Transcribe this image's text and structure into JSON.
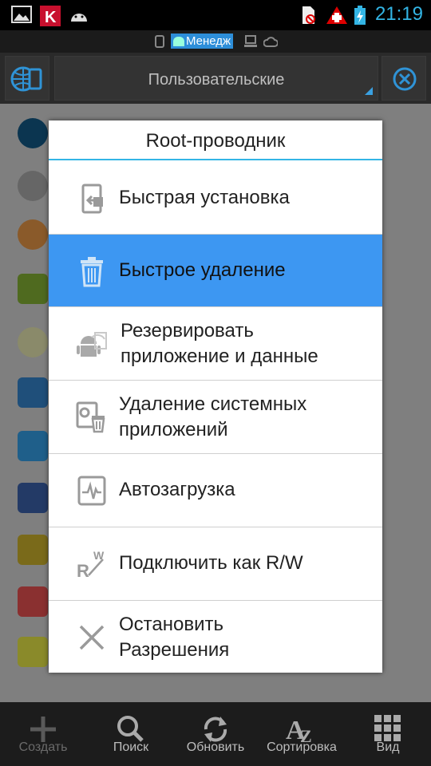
{
  "status_bar": {
    "time": "21:19"
  },
  "tabs": {
    "active_label": "Менедж"
  },
  "header": {
    "filter_label": "Пользовательские"
  },
  "dialog": {
    "title": "Root-проводник",
    "items": [
      {
        "line1": "Быстрая установка",
        "line2": "",
        "icon": "install-icon",
        "selected": false
      },
      {
        "line1": "Быстрое удаление",
        "line2": "",
        "icon": "trash-icon",
        "selected": true
      },
      {
        "line1": "Резервировать",
        "line2": "приложение и данные",
        "icon": "android-backup-icon",
        "selected": false
      },
      {
        "line1": "Удаление системных",
        "line2": "приложений",
        "icon": "system-uninstall-icon",
        "selected": false
      },
      {
        "line1": "Автозагрузка",
        "line2": "",
        "icon": "autostart-icon",
        "selected": false
      },
      {
        "line1": "Подключить как R/W",
        "line2": "",
        "icon": "mount-rw-icon",
        "selected": false
      },
      {
        "line1": "Остановить",
        "line2": "Разрешения",
        "icon": "close-x-icon",
        "selected": false
      }
    ]
  },
  "toolbar": {
    "create": "Создать",
    "search": "Поиск",
    "refresh": "Обновить",
    "sort": "Сортировка",
    "view": "Вид"
  },
  "colors": {
    "accent": "#33b5e5",
    "selected": "#3d97f2"
  }
}
